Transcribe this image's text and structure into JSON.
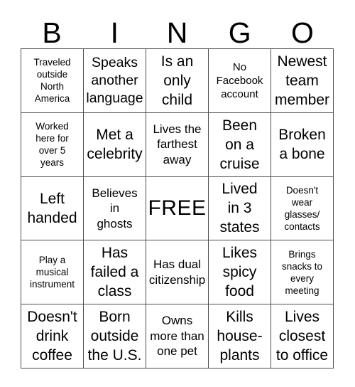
{
  "card": {
    "title": "BINGO",
    "header_letters": [
      "B",
      "I",
      "N",
      "G",
      "O"
    ],
    "free_space_label": "FREE",
    "colors": {
      "background": "#ffffff",
      "text": "#000000",
      "grid_line": "#4d4d4d"
    },
    "grid": {
      "columns": 5,
      "rows": 5,
      "cells": [
        {
          "text": "Traveled\noutside\nNorth\nAmerica",
          "size": "fs-xs",
          "free": false
        },
        {
          "text": "Speaks\nanother\nlanguage",
          "size": "fs-lg",
          "free": false
        },
        {
          "text": "Is an\nonly\nchild",
          "size": "fs-xl",
          "free": false
        },
        {
          "text": "No\nFacebook\naccount",
          "size": "fs-sm",
          "free": false
        },
        {
          "text": "Newest\nteam\nmember",
          "size": "fs-xl",
          "free": false
        },
        {
          "text": "Worked\nhere for\nover 5\nyears",
          "size": "fs-xs",
          "free": false
        },
        {
          "text": "Met a\ncelebrity",
          "size": "fs-xl",
          "free": false
        },
        {
          "text": "Lives the\nfarthest\naway",
          "size": "fs-md",
          "free": false
        },
        {
          "text": "Been\non a\ncruise",
          "size": "fs-xl",
          "free": false
        },
        {
          "text": "Broken\na bone",
          "size": "fs-xl",
          "free": false
        },
        {
          "text": "Left\nhanded",
          "size": "fs-xl",
          "free": false
        },
        {
          "text": "Believes\nin\nghosts",
          "size": "fs-md",
          "free": false
        },
        {
          "text": "FREE",
          "size": "fs-free",
          "free": true
        },
        {
          "text": "Lived\nin 3\nstates",
          "size": "fs-xl",
          "free": false
        },
        {
          "text": "Doesn't\nwear\nglasses/\ncontacts",
          "size": "fs-xs",
          "free": false
        },
        {
          "text": "Play a\nmusical\ninstrument",
          "size": "fs-xs",
          "free": false
        },
        {
          "text": "Has\nfailed a\nclass",
          "size": "fs-xl",
          "free": false
        },
        {
          "text": "Has dual\ncitizenship",
          "size": "fs-md",
          "free": false
        },
        {
          "text": "Likes\nspicy\nfood",
          "size": "fs-xl",
          "free": false
        },
        {
          "text": "Brings\nsnacks to\nevery\nmeeting",
          "size": "fs-xs",
          "free": false
        },
        {
          "text": "Doesn't\ndrink\ncoffee",
          "size": "fs-xl",
          "free": false
        },
        {
          "text": "Born\noutside\nthe U.S.",
          "size": "fs-xl",
          "free": false
        },
        {
          "text": "Owns\nmore than\none pet",
          "size": "fs-md",
          "free": false
        },
        {
          "text": "Kills\nhouse-\nplants",
          "size": "fs-xl",
          "free": false
        },
        {
          "text": "Lives\nclosest\nto office",
          "size": "fs-xl",
          "free": false
        }
      ]
    }
  }
}
